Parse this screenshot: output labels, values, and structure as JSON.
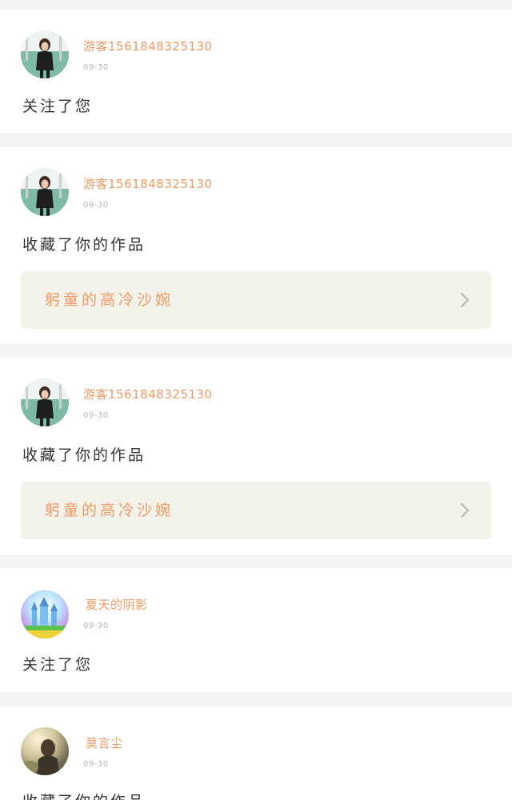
{
  "notifications": [
    {
      "username": "游客1561848325130",
      "date": "09-30",
      "action": "关注了您"
    },
    {
      "username": "游客1561848325130",
      "date": "09-30",
      "action": "收藏了你的作品",
      "work_title": "躬童的高冷沙婉"
    },
    {
      "username": "游客1561848325130",
      "date": "09-30",
      "action": "收藏了你的作品",
      "work_title": "躬童的高冷沙婉"
    },
    {
      "username": "夏天的阴影",
      "date": "09-30",
      "action": "关注了您"
    },
    {
      "username": "莫言尘",
      "date": "09-30",
      "action": "收藏了你的作品"
    }
  ],
  "icons": {
    "chevron": "chevron-right-icon",
    "avatar_person": "avatar-photo-woman",
    "avatar_castle": "avatar-photo-castle"
  },
  "colors": {
    "accent": "#ef9a64",
    "page_background": "#f4f4f4",
    "card_background": "#ffffff",
    "work_box_background": "#f2f1ea",
    "date_text": "#b6b6b6",
    "body_text": "#333333"
  }
}
